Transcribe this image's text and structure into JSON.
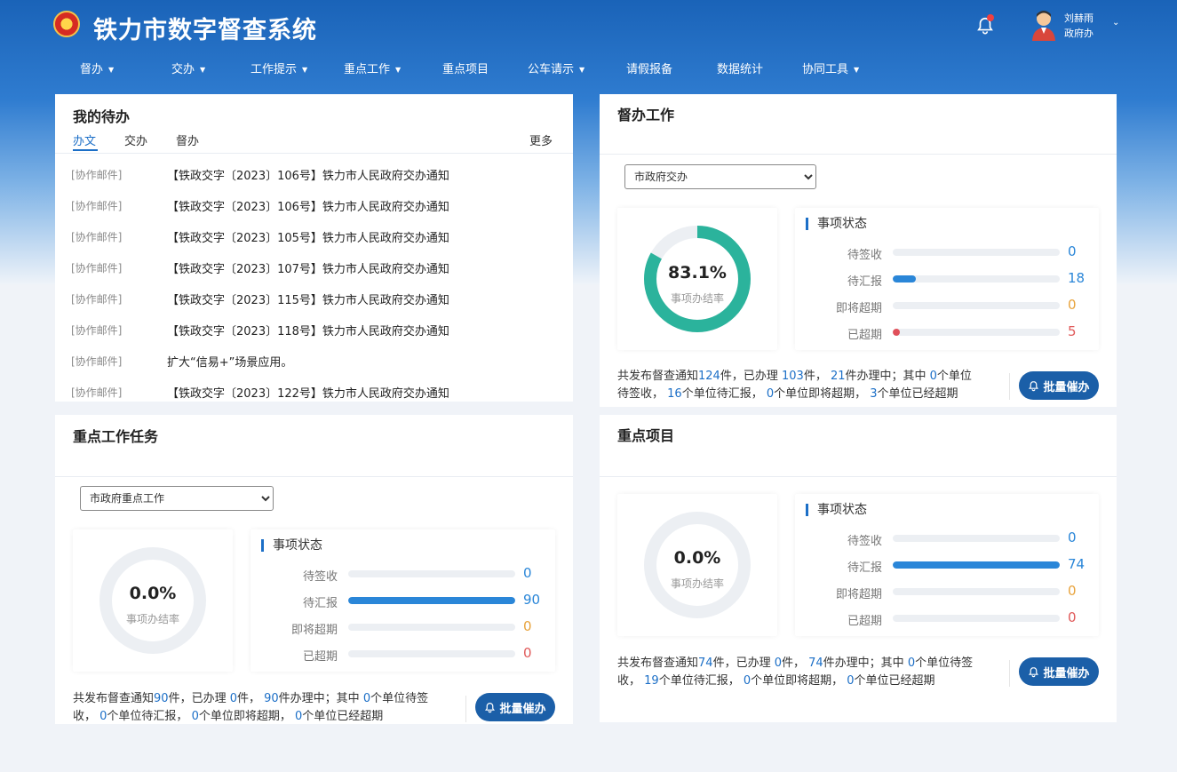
{
  "app": {
    "title": "铁力市数字督查系统"
  },
  "user": {
    "name": "刘赫雨",
    "dept": "政府办"
  },
  "nav": [
    {
      "label": "督办",
      "dropdown": true
    },
    {
      "label": "交办",
      "dropdown": true
    },
    {
      "label": "工作提示",
      "dropdown": true
    },
    {
      "label": "重点工作",
      "dropdown": true
    },
    {
      "label": "重点项目",
      "dropdown": false
    },
    {
      "label": "公车请示",
      "dropdown": true
    },
    {
      "label": "请假报备",
      "dropdown": false
    },
    {
      "label": "数据统计",
      "dropdown": false
    },
    {
      "label": "协同工具",
      "dropdown": true
    }
  ],
  "todo": {
    "title": "我的待办",
    "tabs": [
      "办文",
      "交办",
      "督办"
    ],
    "active_tab": "办文",
    "more": "更多",
    "rows": [
      {
        "tag": "[协作邮件]",
        "text": "【铁政交字〔2023〕106号】铁力市人民政府交办通知"
      },
      {
        "tag": "[协作邮件]",
        "text": "【铁政交字〔2023〕106号】铁力市人民政府交办通知"
      },
      {
        "tag": "[协作邮件]",
        "text": "【铁政交字〔2023〕105号】铁力市人民政府交办通知"
      },
      {
        "tag": "[协作邮件]",
        "text": "【铁政交字〔2023〕107号】铁力市人民政府交办通知"
      },
      {
        "tag": "[协作邮件]",
        "text": "【铁政交字〔2023〕115号】铁力市人民政府交办通知"
      },
      {
        "tag": "[协作邮件]",
        "text": "【铁政交字〔2023〕118号】铁力市人民政府交办通知"
      },
      {
        "tag": "[协作邮件]",
        "text": "扩大“信易+”场景应用。"
      },
      {
        "tag": "[协作邮件]",
        "text": "【铁政交字〔2023〕122号】铁力市人民政府交办通知"
      }
    ]
  },
  "colors": {
    "ring_done": "#2bb39c",
    "ring_track": "#eceff3",
    "bar_blue": "#2a86d8",
    "bar_red": "#e0505a",
    "val_blue": "#2a86d8",
    "val_orange": "#e8a33c",
    "val_red": "#e05a5a"
  },
  "supervise": {
    "title": "督办工作",
    "select": "市政府交办",
    "rate": 0.831,
    "rate_text": "83.1%",
    "rate_label": "事项办结率",
    "status_title": "事项状态",
    "statuses": [
      {
        "label": "待签收",
        "value": 0,
        "fill": 0
      },
      {
        "label": "待汇报",
        "value": 18,
        "fill": 0.14
      },
      {
        "label": "即将超期",
        "value": 0,
        "fill": 0
      },
      {
        "label": "已超期",
        "value": 5,
        "fill": 0.04
      }
    ],
    "summary": [
      "共发布督查通知",
      "124",
      "件，已办理 ",
      "103",
      "件， ",
      "21",
      "件办理中；其中 ",
      "0",
      "个单位",
      "待签收， ",
      "16",
      "个单位待汇报， ",
      "0",
      "个单位即将超期， ",
      "3",
      "个单位已经超期"
    ],
    "button": "批量催办"
  },
  "keywork": {
    "title": "重点工作任务",
    "select": "市政府重点工作",
    "rate": 0.0,
    "rate_text": "0.0%",
    "rate_label": "事项办结率",
    "status_title": "事项状态",
    "statuses": [
      {
        "label": "待签收",
        "value": 0,
        "fill": 0
      },
      {
        "label": "待汇报",
        "value": 90,
        "fill": 1.0
      },
      {
        "label": "即将超期",
        "value": 0,
        "fill": 0
      },
      {
        "label": "已超期",
        "value": 0,
        "fill": 0
      }
    ],
    "summary": [
      "共发布督查通知",
      "90",
      "件，已办理 ",
      "0",
      "件， ",
      "90",
      "件办理中；其中 ",
      "0",
      "个单位待签",
      "收， ",
      "0",
      "个单位待汇报， ",
      "0",
      "个单位即将超期， ",
      "0",
      "个单位已经超期"
    ],
    "button": "批量催办"
  },
  "project": {
    "title": "重点项目",
    "rate": 0.0,
    "rate_text": "0.0%",
    "rate_label": "事项办结率",
    "status_title": "事项状态",
    "statuses": [
      {
        "label": "待签收",
        "value": 0,
        "fill": 0
      },
      {
        "label": "待汇报",
        "value": 74,
        "fill": 1.0
      },
      {
        "label": "即将超期",
        "value": 0,
        "fill": 0
      },
      {
        "label": "已超期",
        "value": 0,
        "fill": 0
      }
    ],
    "summary": [
      "共发布督查通知",
      "74",
      "件，已办理 ",
      "0",
      "件， ",
      "74",
      "件办理中；其中 ",
      "0",
      "个单位待签",
      "收， ",
      "19",
      "个单位待汇报， ",
      "0",
      "个单位即将超期， ",
      "0",
      "个单位已经超期"
    ],
    "button": "批量催办"
  }
}
